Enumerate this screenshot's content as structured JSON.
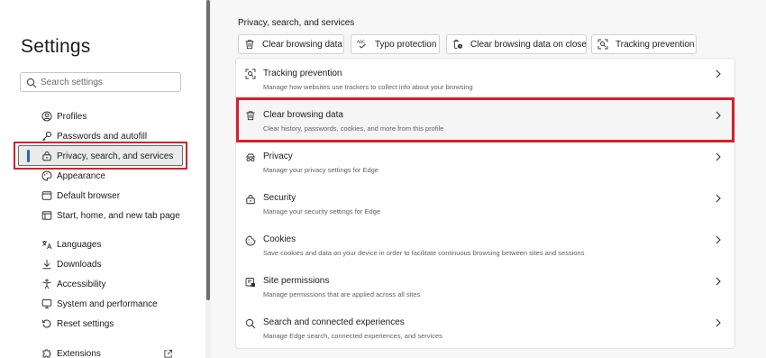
{
  "sidebar": {
    "title": "Settings",
    "search_placeholder": "Search settings",
    "items": [
      {
        "label": "Profiles",
        "icon": "profile-icon"
      },
      {
        "label": "Passwords and autofill",
        "icon": "key-icon"
      },
      {
        "label": "Privacy, search, and services",
        "icon": "lock-icon",
        "active": true
      },
      {
        "label": "Appearance",
        "icon": "appearance-icon"
      },
      {
        "label": "Default browser",
        "icon": "browser-icon"
      },
      {
        "label": "Start, home, and new tab page",
        "icon": "home-icon"
      },
      {
        "label": "Languages",
        "icon": "languages-icon"
      },
      {
        "label": "Downloads",
        "icon": "download-icon"
      },
      {
        "label": "Accessibility",
        "icon": "accessibility-icon"
      },
      {
        "label": "System and performance",
        "icon": "system-icon"
      },
      {
        "label": "Reset settings",
        "icon": "reset-icon"
      },
      {
        "label": "Extensions",
        "icon": "extensions-icon"
      }
    ]
  },
  "main": {
    "section_title": "Privacy, search, and services",
    "quick_actions": [
      {
        "label": "Clear browsing data",
        "icon": "trash-icon"
      },
      {
        "label": "Typo protection",
        "icon": "abc-check-icon"
      },
      {
        "label": "Clear browsing data on close",
        "icon": "trash-clock-icon"
      },
      {
        "label": "Tracking prevention",
        "icon": "tracking-icon"
      }
    ],
    "rows": [
      {
        "title": "Tracking prevention",
        "desc": "Manage how websites use trackers to collect info about your browsing",
        "icon": "tracking-icon"
      },
      {
        "title": "Clear browsing data",
        "desc": "Clear history, passwords, cookies, and more from this profile",
        "icon": "trash-icon",
        "highlighted": true
      },
      {
        "title": "Privacy",
        "desc": "Manage your privacy settings for Edge",
        "icon": "privacy-icon"
      },
      {
        "title": "Security",
        "desc": "Manage your security settings for Edge",
        "icon": "security-lock-icon"
      },
      {
        "title": "Cookies",
        "desc": "Save cookies and data on your device in order to facilitate continuous browsing between sites and sessions",
        "icon": "cookie-icon"
      },
      {
        "title": "Site permissions",
        "desc": "Manage permissions that are applied across all sites",
        "icon": "site-permissions-icon"
      },
      {
        "title": "Search and connected experiences",
        "desc": "Manage Edge search, connected experiences, and services",
        "icon": "search-icon"
      }
    ]
  },
  "colors": {
    "highlight_red": "#d3212d",
    "active_indicator": "#2a62c9",
    "main_bg": "#f7f7f7"
  }
}
